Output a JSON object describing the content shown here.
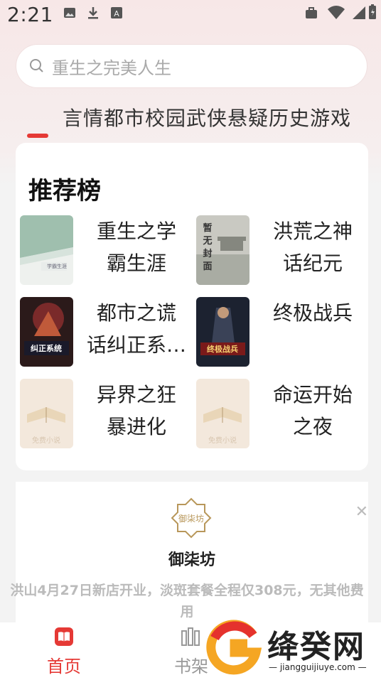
{
  "status_bar": {
    "time": "2:21"
  },
  "search": {
    "placeholder": "重生之完美人生"
  },
  "categories": [
    "言情",
    "都市",
    "校园",
    "武侠",
    "悬疑",
    "历史",
    "游戏"
  ],
  "categories_text": "言情都市校园武侠悬疑历史游戏",
  "recommend": {
    "title": "推荐榜",
    "books": [
      {
        "title": "重生之学霸生涯",
        "title_line1": "重生之学",
        "title_line2": "霸生涯",
        "cover_text": "重生之\n学霸生涯"
      },
      {
        "title": "洪荒之神话纪元",
        "title_line1": "洪荒之神",
        "title_line2": "话纪元",
        "cover_text": "暂无封面"
      },
      {
        "title": "都市之谎话纠正系…",
        "title_line1": "都市之谎",
        "title_line2": "话纠正系…",
        "cover_text": "都市之谎话纠正系统"
      },
      {
        "title": "终极战兵",
        "title_line1": "终极战兵",
        "title_line2": "",
        "cover_text": "终极战兵"
      },
      {
        "title": "异界之狂暴进化",
        "title_line1": "异界之狂",
        "title_line2": "暴进化",
        "cover_text": "免费小说"
      },
      {
        "title": "命运开始之夜",
        "title_line1": "命运开始",
        "title_line2": "之夜",
        "cover_text": "免费小说"
      }
    ]
  },
  "ad": {
    "name": "御柒坊",
    "logo_text": "御柒坊",
    "description": "洪山4月27日新店开业，淡斑套餐全程仅308元，无其他费用",
    "close_icon": "close-icon"
  },
  "bottom_nav": [
    {
      "label": "首页",
      "icon": "book-icon",
      "active": true
    },
    {
      "label": "书架",
      "icon": "bookshelf-icon",
      "active": false
    }
  ],
  "watermark": {
    "text": "绛癸网",
    "url": "jiangguijiuye.com"
  },
  "colors": {
    "accent": "#e53935",
    "bg_top": "#f7e7e7",
    "card": "#ffffff"
  }
}
